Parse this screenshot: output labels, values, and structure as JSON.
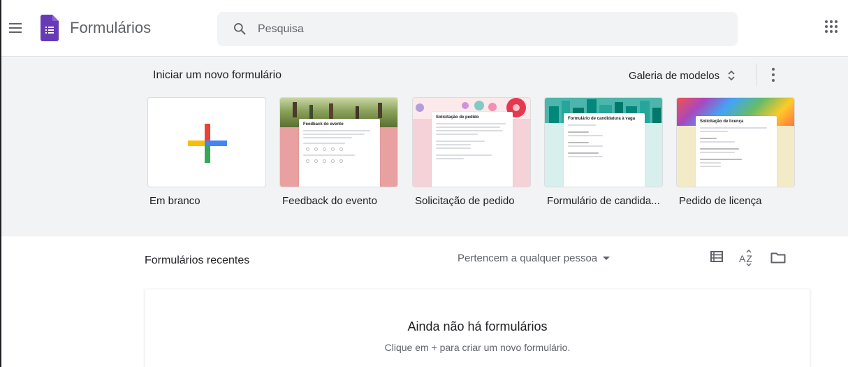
{
  "header": {
    "app_title": "Formulários",
    "search": {
      "placeholder": "Pesquisa",
      "value": ""
    }
  },
  "templates": {
    "section_title": "Iniciar um novo formulário",
    "gallery_label": "Galeria de modelos",
    "items": [
      {
        "label": "Em branco"
      },
      {
        "label": "Feedback do evento",
        "thumb_heading": "Feedback do evento",
        "color": "#e57373"
      },
      {
        "label": "Solicitação de pedido",
        "thumb_heading": "Solicitação de pedido",
        "color": "#f8bbd0"
      },
      {
        "label": "Formulário de candida...",
        "thumb_heading": "Formulário de candidatura à vaga",
        "color": "#26a69a"
      },
      {
        "label": "Pedido de licença",
        "thumb_heading": "Solicitação de licença",
        "color": "#f0e6b8"
      }
    ]
  },
  "recent": {
    "title": "Formulários recentes",
    "owner_filter": "Pertencem a qualquer pessoa",
    "sort_label": "AZ",
    "empty_title": "Ainda não há formulários",
    "empty_subtitle": "Clique em + para criar um novo formulário."
  },
  "colors": {
    "forms_purple": "#673ab7",
    "background_gray": "#f1f3f4",
    "google_red": "#ea4335",
    "google_blue": "#4285f4",
    "google_yellow": "#fbbc04",
    "google_green": "#34a853"
  },
  "icons": [
    "hamburger-menu-icon",
    "forms-logo-icon",
    "search-icon",
    "apps-grid-icon",
    "sort-arrows-icon",
    "more-vert-icon",
    "plus-icon",
    "list-view-icon",
    "sort-az-icon",
    "folder-icon"
  ]
}
